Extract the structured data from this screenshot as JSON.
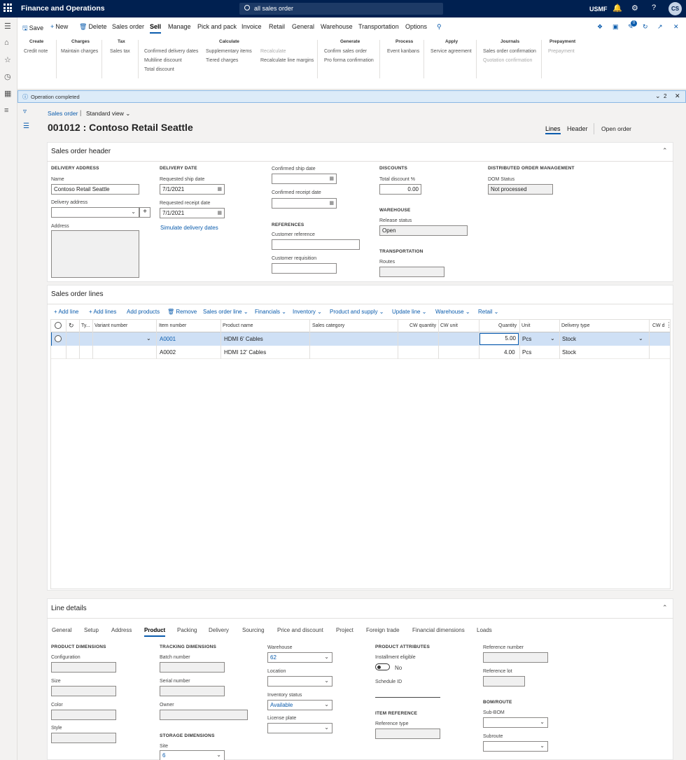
{
  "topbar": {
    "title": "Finance and Operations",
    "search": "all sales order",
    "company": "USMF",
    "avatar": "CS"
  },
  "toolbar": {
    "save": "Save",
    "new": "New",
    "delete": "Delete",
    "tabs": [
      "Sales order",
      "Sell",
      "Manage",
      "Pick and pack",
      "Invoice",
      "Retail",
      "General",
      "Warehouse",
      "Transportation",
      "Options"
    ],
    "badge": "0"
  },
  "groups": {
    "create": {
      "title": "Create",
      "items": [
        "Credit note"
      ]
    },
    "charges": {
      "title": "Charges",
      "items": [
        "Maintain charges"
      ]
    },
    "tax": {
      "title": "Tax",
      "items": [
        "Sales tax"
      ]
    },
    "calculate": {
      "title": "Calculate",
      "items": [
        "Confirmed delivery dates",
        "Multiline discount",
        "Total discount",
        "Supplementary items",
        "Tiered charges",
        "Recalculate",
        "Recalculate line margins"
      ]
    },
    "generate": {
      "title": "Generate",
      "items": [
        "Confirm sales order",
        "Pro forma confirmation"
      ]
    },
    "process": {
      "title": "Process",
      "items": [
        "Event kanbans"
      ]
    },
    "apply": {
      "title": "Apply",
      "items": [
        "Service agreement"
      ]
    },
    "journals": {
      "title": "Journals",
      "items": [
        "Sales order confirmation",
        "Quotation confirmation"
      ]
    },
    "prepayment": {
      "title": "Prepayment",
      "items": [
        "Prepayment"
      ]
    }
  },
  "message": {
    "text": "Operation completed",
    "count": "2"
  },
  "breadcrumb": {
    "root": "Sales order",
    "view": "Standard view"
  },
  "page": {
    "title": "001012 : Contoso Retail Seattle",
    "views": [
      "Lines",
      "Header",
      "Open order"
    ]
  },
  "header": {
    "title": "Sales order header",
    "delivery_address": {
      "label": "DELIVERY ADDRESS",
      "name_label": "Name",
      "name": "Contoso Retail Seattle",
      "addr_label": "Delivery address",
      "address_label": "Address"
    },
    "delivery_date": {
      "label": "DELIVERY DATE",
      "req_ship_label": "Requested ship date",
      "req_ship": "7/1/2021",
      "req_receipt_label": "Requested receipt date",
      "req_receipt": "7/1/2021",
      "simulate": "Simulate delivery dates"
    },
    "confirmed": {
      "ship_label": "Confirmed ship date",
      "receipt_label": "Confirmed receipt date"
    },
    "references": {
      "label": "REFERENCES",
      "cust_ref": "Customer reference",
      "cust_req": "Customer requisition"
    },
    "discounts": {
      "label": "DISCOUNTS",
      "total_label": "Total discount %",
      "total": "0.00"
    },
    "warehouse": {
      "label": "WAREHOUSE",
      "release_label": "Release status",
      "release": "Open"
    },
    "transportation": {
      "label": "TRANSPORTATION",
      "routes_label": "Routes"
    },
    "dom": {
      "label": "DISTRIBUTED ORDER MANAGEMENT",
      "status_label": "DOM Status",
      "status": "Not processed"
    }
  },
  "lines": {
    "title": "Sales order lines",
    "toolbar": [
      "Add line",
      "Add lines",
      "Add products",
      "Remove",
      "Sales order line",
      "Financials",
      "Inventory",
      "Product and supply",
      "Update line",
      "Warehouse",
      "Retail"
    ],
    "columns": [
      "Ty...",
      "Variant number",
      "Item number",
      "Product name",
      "Sales category",
      "CW quantity",
      "CW unit",
      "Quantity",
      "Unit",
      "Delivery type",
      "CW d"
    ],
    "rows": [
      {
        "item": "A0001",
        "name": "HDMI 6' Cables",
        "qty": "5.00",
        "unit": "Pcs",
        "delivery": "Stock"
      },
      {
        "item": "A0002",
        "name": "HDMI 12' Cables",
        "qty": "4.00",
        "unit": "Pcs",
        "delivery": "Stock"
      }
    ]
  },
  "line_details": {
    "title": "Line details",
    "tabs": [
      "General",
      "Setup",
      "Address",
      "Product",
      "Packing",
      "Delivery",
      "Sourcing",
      "Price and discount",
      "Project",
      "Foreign trade",
      "Financial dimensions",
      "Loads"
    ],
    "product_dimensions": {
      "label": "PRODUCT DIMENSIONS",
      "fields": [
        "Configuration",
        "Size",
        "Color",
        "Style"
      ]
    },
    "tracking": {
      "label": "TRACKING DIMENSIONS",
      "fields": [
        "Batch number",
        "Serial number",
        "Owner"
      ]
    },
    "storage": {
      "label": "STORAGE DIMENSIONS",
      "site_label": "Site",
      "site": "6"
    },
    "warehouse": {
      "label": "Warehouse",
      "value": "62",
      "location": "Location",
      "inv_status": "Inventory status",
      "inv_value": "Available",
      "license": "License plate"
    },
    "attributes": {
      "label": "PRODUCT ATTRIBUTES",
      "installment": "Installment eligible",
      "toggle": "No",
      "schedule": "Schedule ID"
    },
    "item_reference": {
      "label": "ITEM REFERENCE",
      "ref_type": "Reference type"
    },
    "reference": {
      "number": "Reference number",
      "lot": "Reference lot"
    },
    "bom": {
      "label": "BOM/ROUTE",
      "subbom": "Sub-BOM",
      "subroute": "Subroute"
    }
  }
}
